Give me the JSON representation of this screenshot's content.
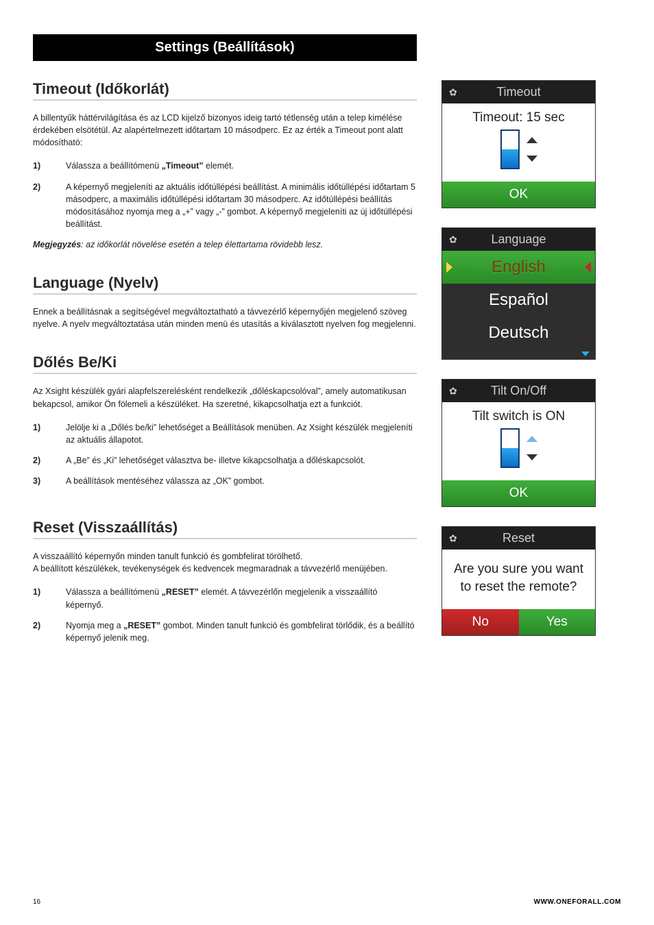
{
  "banner": "Settings (Beállítások)",
  "timeout": {
    "heading": "Timeout (Időkorlát)",
    "intro": "A billentyűk háttérvilágítása és az LCD kijelző bizonyos ideig tartó tétlenség után a telep kimélése érdekében elsötétül. Az alapértelmezett időtartam 10 másodperc. Ez az érték a Timeout pont alatt módosítható:",
    "steps": [
      {
        "n": "1)",
        "html": "Válassza a beállítómenü <b>„Timeout”</b> elemét."
      },
      {
        "n": "2)",
        "html": "A képernyő megjeleníti az aktuális időtúllépési beállítást. A minimális időtúllépési időtartam 5 másodperc, a maximális időtúllépési időtartam 30 másodperc. Az időtúllépési beállítás módosításához nyomja meg a „+” vagy „-” gombot. A képernyő megjeleníti az új időtúllépési beállítást."
      }
    ],
    "note_label": "Megjegyzés",
    "note_text": ": az időkorlát növelése esetén a telep élettartama rövidebb lesz."
  },
  "language": {
    "heading": "Language (Nyelv)",
    "text": "Ennek a beállításnak a segítségével megváltoztatható a távvezérlő képernyőjén megjelenő szöveg nyelve. A nyelv megváltoztatása után minden menü és utasítás a kiválasztott nyelven fog megjelenni."
  },
  "tilt": {
    "heading": "Dőlés Be/Ki",
    "intro": "Az Xsight készülék gyári alapfelszerelésként rendelkezik „dőléskapcsolóval”, amely automatikusan bekapcsol, amikor Ön fölemeli a készüléket. Ha szeretné, kikapcsolhatja ezt a funkciót.",
    "steps": [
      {
        "n": "1)",
        "html": "Jelölje ki a „Dőlés be/ki” lehetőséget a Beállítások menüben. Az Xsight készülék megjeleníti az aktuális állapotot."
      },
      {
        "n": "2)",
        "html": "A „Be” és „Ki” lehetőséget választva be- illetve kikapcsolhatja a dőléskapcsolót."
      },
      {
        "n": "3)",
        "html": "A beállítások mentéséhez válassza az „OK” gombot."
      }
    ]
  },
  "reset": {
    "heading": "Reset (Visszaállítás)",
    "intro1": "A visszaállító képernyőn minden tanult funkció és gombfelirat törölhető.",
    "intro2": "A beállított készülékek, tevékenységek és kedvencek megmaradnak a távvezérlő menüjében.",
    "steps": [
      {
        "n": "1)",
        "html": "Válassza a beállítómenü <b>„RESET”</b> elemét. A távvezérlőn megjelenik a visszaállító képernyő."
      },
      {
        "n": "2)",
        "html": "Nyomja meg a <b>„RESET”</b> gombot. Minden tanult funkció és gombfelirat törlődik, és a beállító képernyő jelenik meg."
      }
    ]
  },
  "screens": {
    "timeout": {
      "title": "Timeout",
      "line": "Timeout: 15 sec",
      "ok": "OK",
      "fill_pct": 50
    },
    "language": {
      "title": "Language",
      "items": [
        "English",
        "Español",
        "Deutsch"
      ],
      "selected": 0
    },
    "tilt": {
      "title": "Tilt On/Off",
      "line": "Tilt switch is ON",
      "ok": "OK",
      "fill_pct": 50
    },
    "reset": {
      "title": "Reset",
      "question": "Are you sure you want to reset the remote?",
      "no": "No",
      "yes": "Yes"
    }
  },
  "footer": {
    "page": "16",
    "url": "WWW.ONEFORALL.COM"
  }
}
